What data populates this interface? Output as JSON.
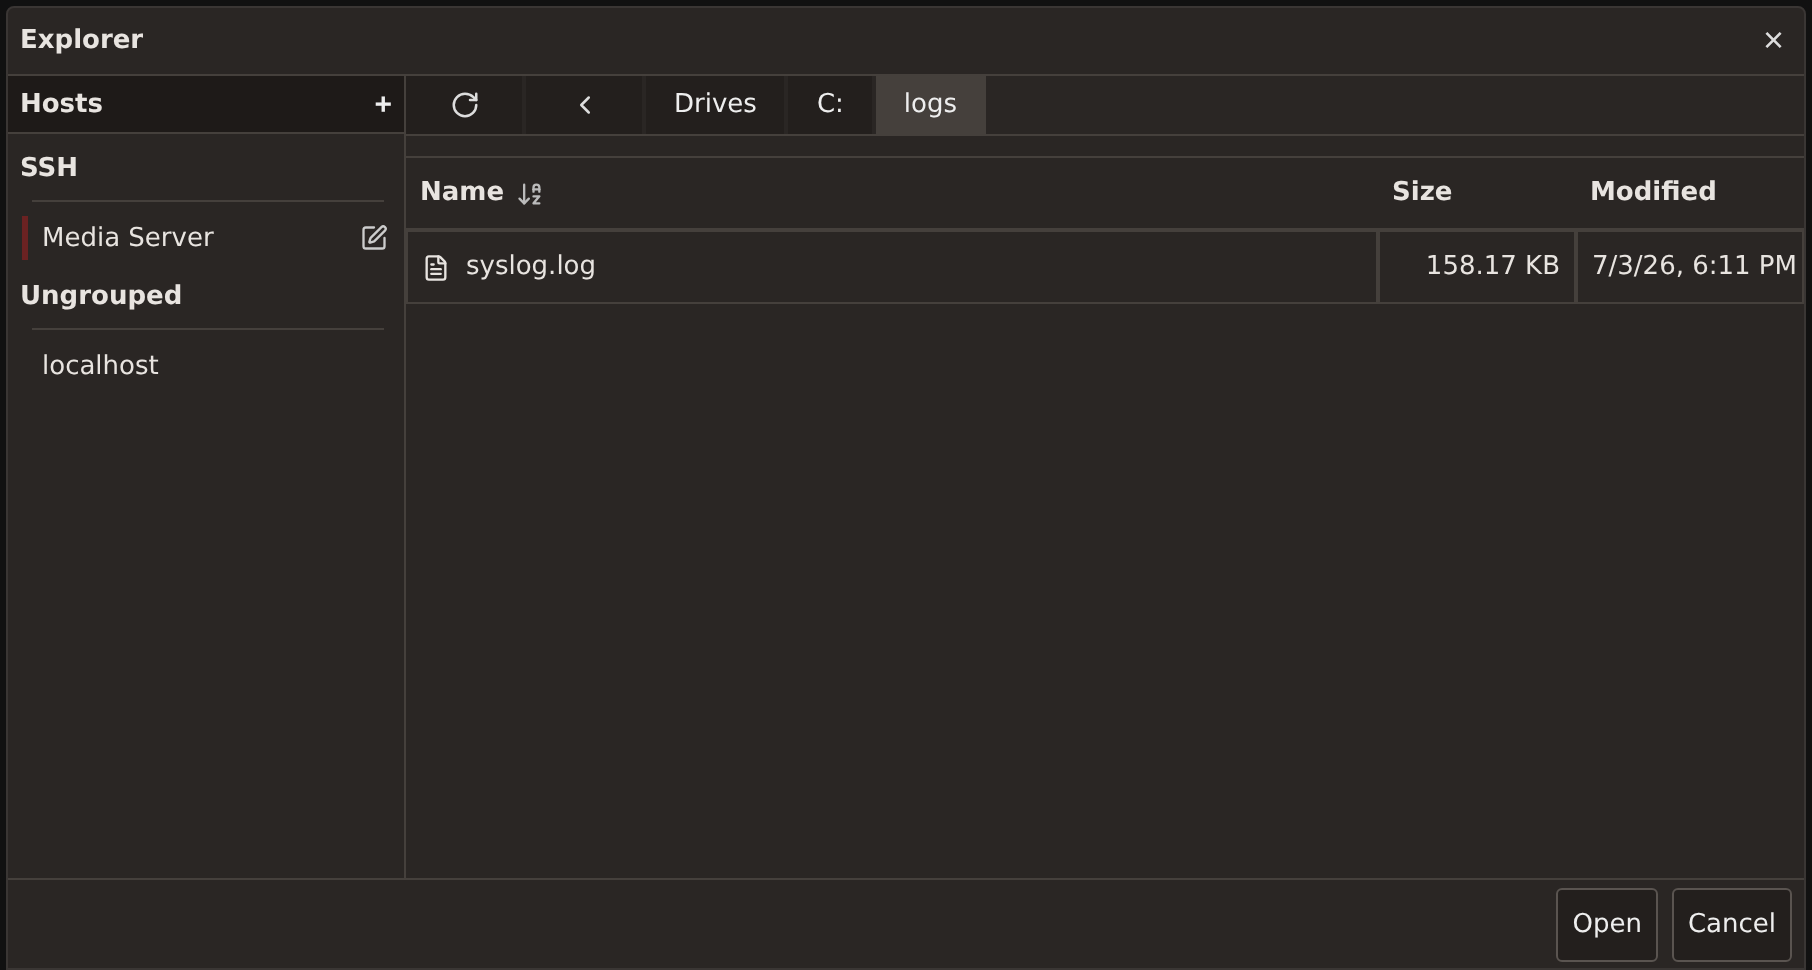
{
  "window": {
    "title": "Explorer",
    "close": "×"
  },
  "sidebar": {
    "title": "Hosts",
    "add": "+",
    "groups": [
      {
        "name": "SSH",
        "hosts": [
          {
            "name": "Media Server",
            "color": "#6b2222",
            "hovered": true
          }
        ]
      },
      {
        "name": "Ungrouped",
        "hosts": [
          {
            "name": "localhost",
            "hovered": false
          }
        ]
      }
    ]
  },
  "path": [
    {
      "label": "Drives",
      "selected": false
    },
    {
      "label": "C:",
      "selected": false
    },
    {
      "label": "logs",
      "selected": true
    }
  ],
  "table": {
    "columns": [
      {
        "label": "Name",
        "sorted": true,
        "kind": "text"
      },
      {
        "label": "Size",
        "sorted": false,
        "kind": "number"
      },
      {
        "label": "Modified",
        "sorted": false,
        "kind": "text"
      }
    ],
    "rows": [
      {
        "cells": [
          "syslog.log",
          "158.17 KB",
          "7/3/26, 6:11 PM"
        ]
      }
    ]
  },
  "buttons": [
    "Open",
    "Cancel"
  ]
}
